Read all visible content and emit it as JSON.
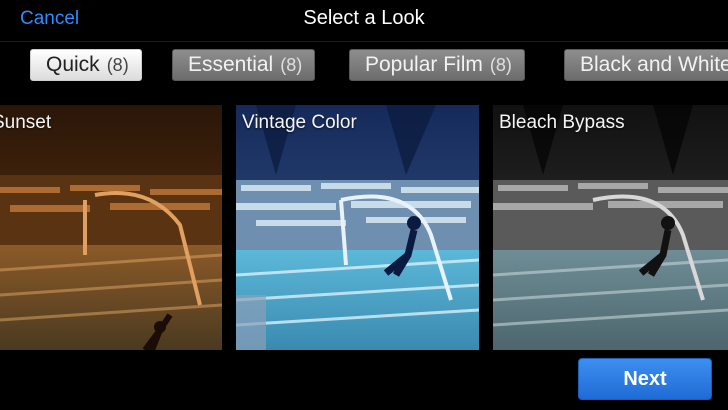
{
  "header": {
    "cancel_label": "Cancel",
    "title": "Select a Look"
  },
  "tabs": [
    {
      "label": "Quick",
      "count": "(8)"
    },
    {
      "label": "Essential",
      "count": "(8)"
    },
    {
      "label": "Popular Film",
      "count": "(8)"
    },
    {
      "label": "Black and White"
    }
  ],
  "looks": [
    {
      "label": "Sunset"
    },
    {
      "label": "Vintage Color"
    },
    {
      "label": "Bleach Bypass"
    }
  ],
  "footer": {
    "next_label": "Next"
  },
  "colors": {
    "accent": "#2d8cff",
    "next_button": "#2a7be4"
  }
}
